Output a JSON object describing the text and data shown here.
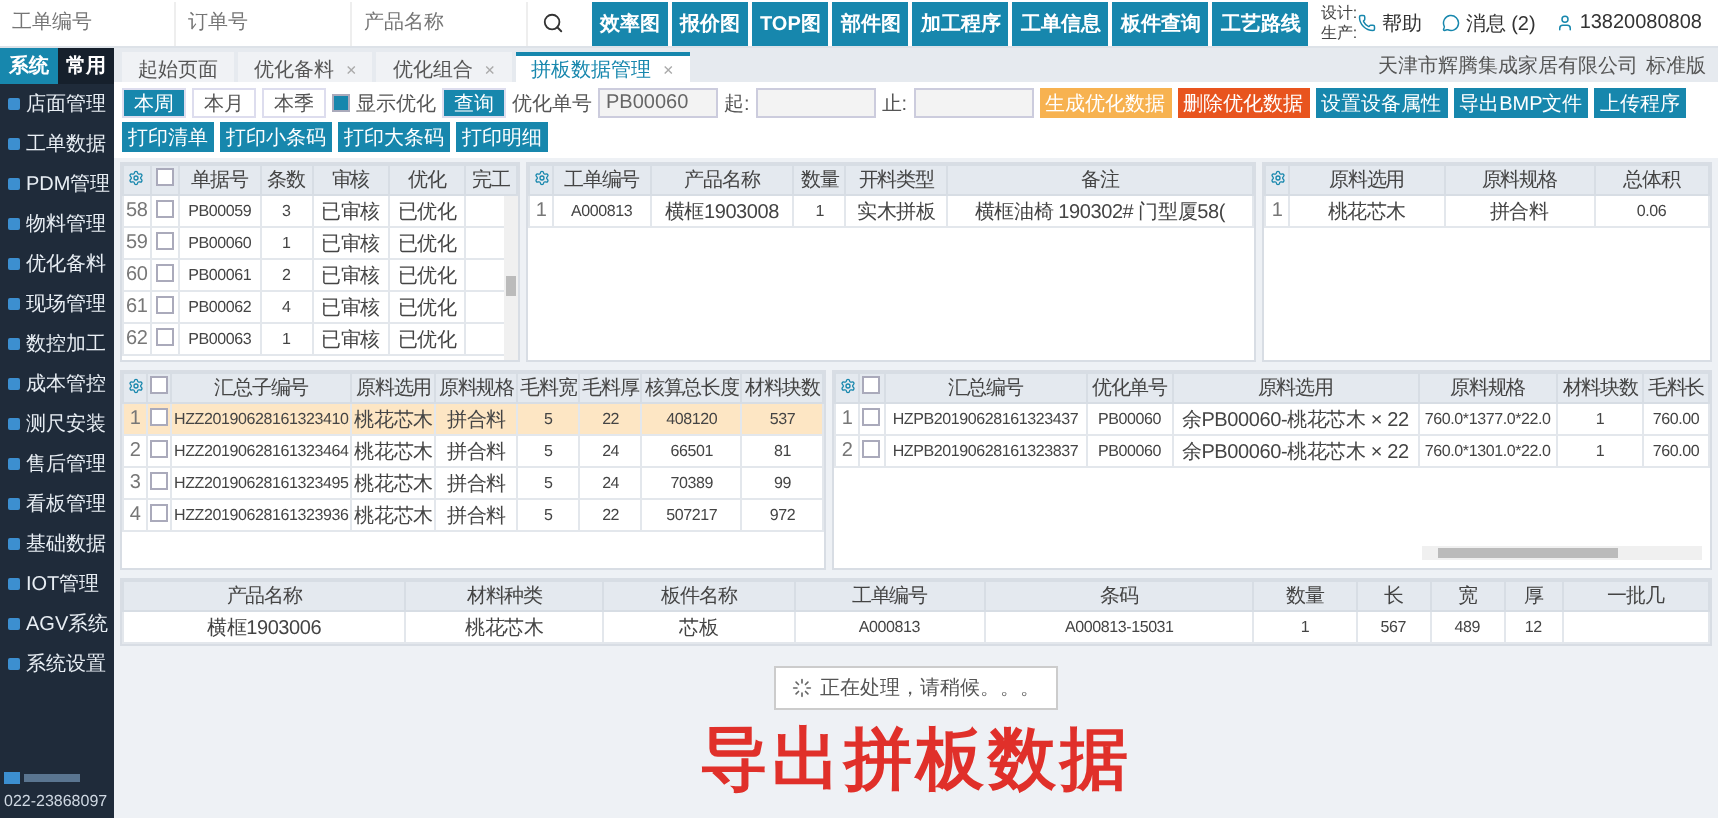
{
  "top_bar": {
    "search_fields": [
      {
        "placeholder": "工单编号"
      },
      {
        "placeholder": "订单号"
      },
      {
        "placeholder": "产品名称"
      }
    ],
    "nav_buttons": [
      "效率图",
      "报价图",
      "TOP图",
      "部件图",
      "加工程序",
      "工单信息",
      "板件查询",
      "工艺路线"
    ],
    "info_labels": [
      "设计:",
      "生产:"
    ],
    "links": [
      {
        "kind": "help",
        "label": "帮助"
      },
      {
        "kind": "message",
        "label": "消息 (2)"
      },
      {
        "kind": "user",
        "label": "13820080808"
      }
    ]
  },
  "sidebar": {
    "tabs": [
      {
        "label": "系统",
        "selected": true
      },
      {
        "label": "常用",
        "selected": false
      }
    ],
    "items": [
      "店面管理",
      "工单数据",
      "PDM管理",
      "物料管理",
      "优化备料",
      "现场管理",
      "数控加工",
      "成本管控",
      "测尺安装",
      "售后管理",
      "看板管理",
      "基础数据",
      "IOT管理",
      "AGV系统",
      "系统设置"
    ],
    "footer_phone": "022-23868097"
  },
  "page_tabs": [
    {
      "label": "起始页面",
      "closable": false,
      "selected": false
    },
    {
      "label": "优化备料",
      "closable": true,
      "selected": false
    },
    {
      "label": "优化组合",
      "closable": true,
      "selected": false
    },
    {
      "label": "拼板数据管理",
      "closable": true,
      "selected": true
    }
  ],
  "close_mark": "×",
  "company": "天津市辉腾集成家居有限公司",
  "edition": "标准版",
  "toolbar": {
    "period_buttons": [
      {
        "label": "本周",
        "selected": true
      },
      {
        "label": "本月",
        "selected": false
      },
      {
        "label": "本季",
        "selected": false
      }
    ],
    "show_optimized": {
      "label": "显示优化",
      "checked": true
    },
    "query_button": "查询",
    "order_field": {
      "label": "优化单号",
      "value": "PB00060"
    },
    "start_field": {
      "label": "起:"
    },
    "end_field": {
      "label": "止:"
    },
    "actions": [
      {
        "label": "生成优化数据",
        "kind": "warning"
      },
      {
        "label": "删除优化数据",
        "kind": "danger"
      },
      {
        "label": "设置设备属性",
        "kind": "primary"
      },
      {
        "label": "导出BMP文件",
        "kind": "primary"
      },
      {
        "label": "上传程序",
        "kind": "primary"
      },
      {
        "label": "打印清单",
        "kind": "primary"
      },
      {
        "label": "打印小条码",
        "kind": "primary"
      },
      {
        "label": "打印大条码",
        "kind": "primary"
      },
      {
        "label": "打印明细",
        "kind": "primary"
      }
    ]
  },
  "orders_table": {
    "select_all": {
      "checked": false
    },
    "columns": [
      "单据号",
      "条数",
      "审核",
      "优化",
      "完工"
    ],
    "rows": [
      {
        "number": "58",
        "checked": false,
        "selected": false,
        "cells": [
          "PB00059",
          "3",
          "已审核",
          "已优化",
          ""
        ]
      },
      {
        "number": "59",
        "checked": false,
        "selected": false,
        "cells": [
          "PB00060",
          "1",
          "已审核",
          "已优化",
          ""
        ]
      },
      {
        "number": "60",
        "checked": false,
        "selected": false,
        "cells": [
          "PB00061",
          "2",
          "已审核",
          "已优化",
          ""
        ]
      },
      {
        "number": "61",
        "checked": false,
        "selected": false,
        "cells": [
          "PB00062",
          "4",
          "已审核",
          "已优化",
          ""
        ]
      },
      {
        "number": "62",
        "checked": false,
        "selected": false,
        "cells": [
          "PB00063",
          "1",
          "已审核",
          "已优化",
          ""
        ]
      }
    ]
  },
  "work_orders_table": {
    "columns": [
      "工单编号",
      "产品名称",
      "数量",
      "开料类型",
      "备注"
    ],
    "rows": [
      {
        "number": "1",
        "selected": false,
        "cells": [
          "A000813",
          "横框1903008",
          "1",
          "实木拼板",
          "横框油椅 190302# 门型厦58("
        ]
      }
    ]
  },
  "materials_table": {
    "columns": [
      "原料选用",
      "原料规格",
      "总体积"
    ],
    "rows": [
      {
        "number": "1",
        "selected": false,
        "cells": [
          "桃花芯木",
          "拼合料",
          "0.06"
        ]
      }
    ]
  },
  "sub_summary_table": {
    "select_all": {
      "checked": false
    },
    "columns": [
      "汇总子编号",
      "原料选用",
      "原料规格",
      "毛料宽",
      "毛料厚",
      "核算总长度",
      "材料块数"
    ],
    "rows": [
      {
        "number": "1",
        "checked": false,
        "selected": true,
        "cells": [
          "HZZ20190628161323410",
          "桃花芯木",
          "拼合料",
          "5",
          "22",
          "408120",
          "537"
        ]
      },
      {
        "number": "2",
        "checked": false,
        "selected": false,
        "cells": [
          "HZZ20190628161323464",
          "桃花芯木",
          "拼合料",
          "5",
          "24",
          "66501",
          "81"
        ]
      },
      {
        "number": "3",
        "checked": false,
        "selected": false,
        "cells": [
          "HZZ20190628161323495",
          "桃花芯木",
          "拼合料",
          "5",
          "24",
          "70389",
          "99"
        ]
      },
      {
        "number": "4",
        "checked": false,
        "selected": false,
        "cells": [
          "HZZ20190628161323936",
          "桃花芯木",
          "拼合料",
          "5",
          "22",
          "507217",
          "972"
        ]
      }
    ]
  },
  "summary_table": {
    "select_all": {
      "checked": false
    },
    "columns": [
      "汇总编号",
      "优化单号",
      "原料选用",
      "原料规格",
      "材料块数",
      "毛料长"
    ],
    "rows": [
      {
        "number": "1",
        "checked": false,
        "selected": false,
        "cells": [
          "HZPB20190628161323437",
          "PB00060",
          "余PB00060-桃花芯木 × 22",
          "760.0*1377.0*22.0",
          "1",
          "760.00"
        ]
      },
      {
        "number": "2",
        "checked": false,
        "selected": false,
        "cells": [
          "HZPB20190628161323837",
          "PB00060",
          "余PB00060-桃花芯木 × 22",
          "760.0*1301.0*22.0",
          "1",
          "760.00"
        ]
      }
    ]
  },
  "parts_table": {
    "columns": [
      "产品名称",
      "材料种类",
      "板件名称",
      "工单编号",
      "条码",
      "数量",
      "长",
      "宽",
      "厚",
      "一批几"
    ],
    "rows": [
      {
        "selected": false,
        "cells": [
          "横框1903006",
          "桃花芯木",
          "芯板",
          "A000813",
          "A000813-15031",
          "1",
          "567",
          "489",
          "12",
          ""
        ]
      }
    ]
  },
  "loading_text": "正在处理，请稍候。。。",
  "caption": "导出拼板数据"
}
